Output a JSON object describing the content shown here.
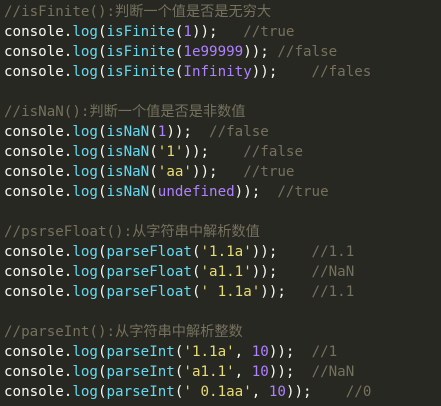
{
  "colors": {
    "background": "#272822",
    "comment": "#75715E",
    "plain": "#F8F8F2",
    "function": "#66D9EF",
    "number": "#AE81FF",
    "string": "#E6DB74",
    "constant": "#AE81FF"
  },
  "lines": [
    [
      {
        "t": "comment",
        "v": "//isFinite():判断一个值是否是无穷大"
      }
    ],
    [
      {
        "t": "plain",
        "v": "console."
      },
      {
        "t": "func",
        "v": "log"
      },
      {
        "t": "plain",
        "v": "("
      },
      {
        "t": "func",
        "v": "isFinite"
      },
      {
        "t": "plain",
        "v": "("
      },
      {
        "t": "num",
        "v": "1"
      },
      {
        "t": "plain",
        "v": "));   "
      },
      {
        "t": "comment",
        "v": "//true"
      }
    ],
    [
      {
        "t": "plain",
        "v": "console."
      },
      {
        "t": "func",
        "v": "log"
      },
      {
        "t": "plain",
        "v": "("
      },
      {
        "t": "func",
        "v": "isFinite"
      },
      {
        "t": "plain",
        "v": "("
      },
      {
        "t": "num",
        "v": "1e99999"
      },
      {
        "t": "plain",
        "v": ")); "
      },
      {
        "t": "comment",
        "v": "//false"
      }
    ],
    [
      {
        "t": "plain",
        "v": "console."
      },
      {
        "t": "func",
        "v": "log"
      },
      {
        "t": "plain",
        "v": "("
      },
      {
        "t": "func",
        "v": "isFinite"
      },
      {
        "t": "plain",
        "v": "("
      },
      {
        "t": "const",
        "v": "Infinity"
      },
      {
        "t": "plain",
        "v": "));    "
      },
      {
        "t": "comment",
        "v": "//fales"
      }
    ],
    [],
    [
      {
        "t": "comment",
        "v": "//isNaN():判断一个值是否是非数值"
      }
    ],
    [
      {
        "t": "plain",
        "v": "console."
      },
      {
        "t": "func",
        "v": "log"
      },
      {
        "t": "plain",
        "v": "("
      },
      {
        "t": "func",
        "v": "isNaN"
      },
      {
        "t": "plain",
        "v": "("
      },
      {
        "t": "num",
        "v": "1"
      },
      {
        "t": "plain",
        "v": "));  "
      },
      {
        "t": "comment",
        "v": "//false"
      }
    ],
    [
      {
        "t": "plain",
        "v": "console."
      },
      {
        "t": "func",
        "v": "log"
      },
      {
        "t": "plain",
        "v": "("
      },
      {
        "t": "func",
        "v": "isNaN"
      },
      {
        "t": "plain",
        "v": "("
      },
      {
        "t": "str",
        "v": "'1'"
      },
      {
        "t": "plain",
        "v": "));    "
      },
      {
        "t": "comment",
        "v": "//false"
      }
    ],
    [
      {
        "t": "plain",
        "v": "console."
      },
      {
        "t": "func",
        "v": "log"
      },
      {
        "t": "plain",
        "v": "("
      },
      {
        "t": "func",
        "v": "isNaN"
      },
      {
        "t": "plain",
        "v": "("
      },
      {
        "t": "str",
        "v": "'aa'"
      },
      {
        "t": "plain",
        "v": "));   "
      },
      {
        "t": "comment",
        "v": "//true"
      }
    ],
    [
      {
        "t": "plain",
        "v": "console."
      },
      {
        "t": "func",
        "v": "log"
      },
      {
        "t": "plain",
        "v": "("
      },
      {
        "t": "func",
        "v": "isNaN"
      },
      {
        "t": "plain",
        "v": "("
      },
      {
        "t": "const",
        "v": "undefined"
      },
      {
        "t": "plain",
        "v": "));  "
      },
      {
        "t": "comment",
        "v": "//true"
      }
    ],
    [],
    [
      {
        "t": "comment",
        "v": "//psrseFloat():从字符串中解析数值"
      }
    ],
    [
      {
        "t": "plain",
        "v": "console."
      },
      {
        "t": "func",
        "v": "log"
      },
      {
        "t": "plain",
        "v": "("
      },
      {
        "t": "func",
        "v": "parseFloat"
      },
      {
        "t": "plain",
        "v": "("
      },
      {
        "t": "str",
        "v": "'1.1a'"
      },
      {
        "t": "plain",
        "v": "));    "
      },
      {
        "t": "comment",
        "v": "//1.1"
      }
    ],
    [
      {
        "t": "plain",
        "v": "console."
      },
      {
        "t": "func",
        "v": "log"
      },
      {
        "t": "plain",
        "v": "("
      },
      {
        "t": "func",
        "v": "parseFloat"
      },
      {
        "t": "plain",
        "v": "("
      },
      {
        "t": "str",
        "v": "'a1.1'"
      },
      {
        "t": "plain",
        "v": "));    "
      },
      {
        "t": "comment",
        "v": "//NaN"
      }
    ],
    [
      {
        "t": "plain",
        "v": "console."
      },
      {
        "t": "func",
        "v": "log"
      },
      {
        "t": "plain",
        "v": "("
      },
      {
        "t": "func",
        "v": "parseFloat"
      },
      {
        "t": "plain",
        "v": "("
      },
      {
        "t": "str",
        "v": "' 1.1a'"
      },
      {
        "t": "plain",
        "v": "));   "
      },
      {
        "t": "comment",
        "v": "//1.1"
      }
    ],
    [],
    [
      {
        "t": "comment",
        "v": "//parseInt():从字符串中解析整数"
      }
    ],
    [
      {
        "t": "plain",
        "v": "console."
      },
      {
        "t": "func",
        "v": "log"
      },
      {
        "t": "plain",
        "v": "("
      },
      {
        "t": "func",
        "v": "parseInt"
      },
      {
        "t": "plain",
        "v": "("
      },
      {
        "t": "str",
        "v": "'1.1a'"
      },
      {
        "t": "plain",
        "v": ", "
      },
      {
        "t": "num",
        "v": "10"
      },
      {
        "t": "plain",
        "v": "));  "
      },
      {
        "t": "comment",
        "v": "//1"
      }
    ],
    [
      {
        "t": "plain",
        "v": "console."
      },
      {
        "t": "func",
        "v": "log"
      },
      {
        "t": "plain",
        "v": "("
      },
      {
        "t": "func",
        "v": "parseInt"
      },
      {
        "t": "plain",
        "v": "("
      },
      {
        "t": "str",
        "v": "'a1.1'"
      },
      {
        "t": "plain",
        "v": ", "
      },
      {
        "t": "num",
        "v": "10"
      },
      {
        "t": "plain",
        "v": "));  "
      },
      {
        "t": "comment",
        "v": "//NaN"
      }
    ],
    [
      {
        "t": "plain",
        "v": "console."
      },
      {
        "t": "func",
        "v": "log"
      },
      {
        "t": "plain",
        "v": "("
      },
      {
        "t": "func",
        "v": "parseInt"
      },
      {
        "t": "plain",
        "v": "("
      },
      {
        "t": "str",
        "v": "' 0.1aa'"
      },
      {
        "t": "plain",
        "v": ", "
      },
      {
        "t": "num",
        "v": "10"
      },
      {
        "t": "plain",
        "v": "));    "
      },
      {
        "t": "comment",
        "v": "//0"
      }
    ]
  ]
}
